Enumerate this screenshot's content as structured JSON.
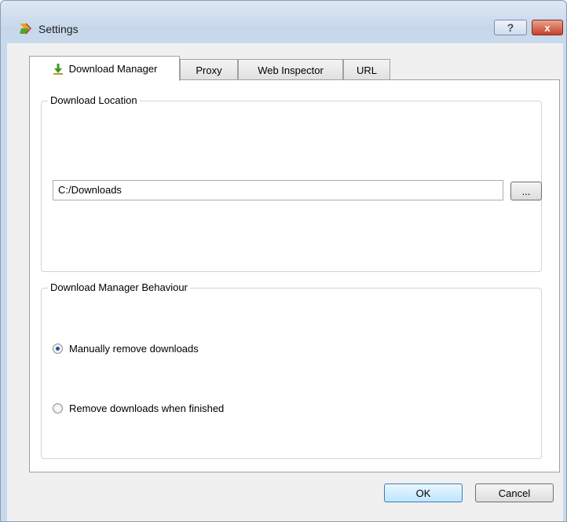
{
  "window": {
    "title": "Settings",
    "help_label": "?",
    "close_label": "x"
  },
  "tabs": [
    {
      "label": "Download Manager",
      "active": true
    },
    {
      "label": "Proxy",
      "active": false
    },
    {
      "label": "Web Inspector",
      "active": false
    },
    {
      "label": "URL",
      "active": false
    }
  ],
  "download_location": {
    "group_title": "Download Location",
    "path_value": "C:/Downloads",
    "browse_label": "..."
  },
  "behaviour": {
    "group_title": "Download Manager Behaviour",
    "options": [
      {
        "label": "Manually remove downloads",
        "checked": true
      },
      {
        "label": "Remove downloads when finished",
        "checked": false
      }
    ]
  },
  "buttons": {
    "ok_label": "OK",
    "cancel_label": "Cancel"
  },
  "colors": {
    "frame": "#c9d9ec",
    "client_bg": "#f0f0f0",
    "radio_dot": "#1e4f9a",
    "close_button": "#c9412a"
  }
}
